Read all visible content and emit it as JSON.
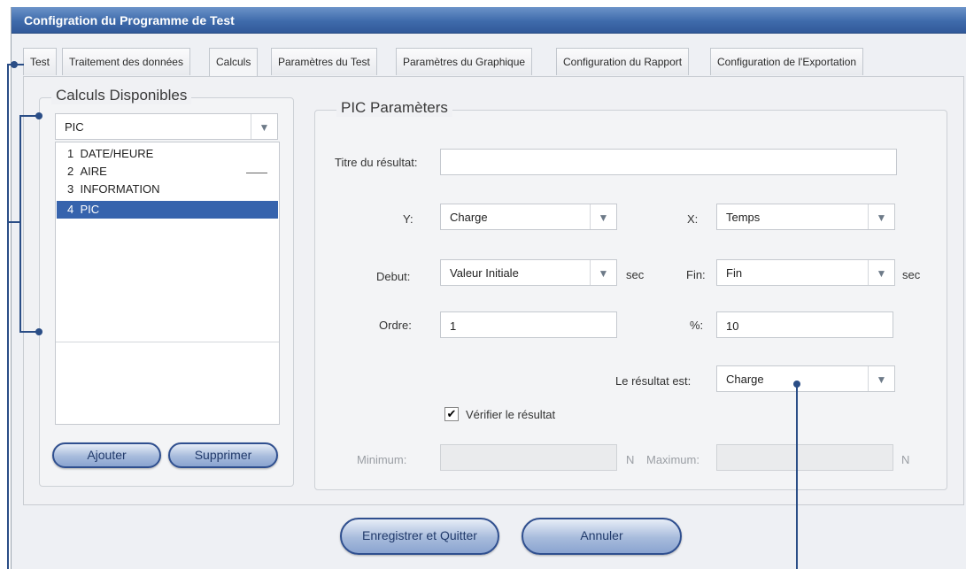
{
  "window": {
    "title": "Configration du Programme de Test"
  },
  "tabs": [
    {
      "label": "Test"
    },
    {
      "label": "Traitement des données"
    },
    {
      "label": "Calculs"
    },
    {
      "label": "Paramètres du Test"
    },
    {
      "label": "Paramètres du Graphique"
    },
    {
      "label": "Configuration du Rapport"
    },
    {
      "label": "Configuration de l'Exportation"
    }
  ],
  "calculs": {
    "legend": "Calculs Disponibles",
    "dropdown_value": "PIC",
    "items": [
      {
        "num": "1",
        "label": "DATE/HEURE",
        "selected": false
      },
      {
        "num": "2",
        "label": "AIRE",
        "selected": false
      },
      {
        "num": "3",
        "label": "INFORMATION",
        "selected": false
      },
      {
        "num": "4",
        "label": "PIC",
        "selected": true
      }
    ],
    "add_label": "Ajouter",
    "delete_label": "Supprimer"
  },
  "params": {
    "legend": "PIC Paramèters",
    "titre_label": "Titre du résultat:",
    "titre_value": "",
    "y_label": "Y:",
    "y_value": "Charge",
    "x_label": "X:",
    "x_value": "Temps",
    "debut_label": "Debut:",
    "debut_value": "Valeur Initiale",
    "debut_unit": "sec",
    "fin_label": "Fin:",
    "fin_value": "Fin",
    "fin_unit": "sec",
    "ordre_label": "Ordre:",
    "ordre_value": "1",
    "pct_label": "%:",
    "pct_value": "10",
    "resultat_label": "Le résultat est:",
    "resultat_value": "Charge",
    "verifier_label": "Vérifier le résultat",
    "verifier_checked": true,
    "min_label": "Minimum:",
    "min_value": "",
    "min_unit": "N",
    "max_label": "Maximum:",
    "max_value": "",
    "max_unit": "N"
  },
  "footer": {
    "save_label": "Enregistrer et Quitter",
    "cancel_label": "Annuler"
  },
  "icons": {
    "dropdown_arrow": "▼",
    "check": "✔"
  },
  "colors": {
    "title_bar": "#3f6bab",
    "selection": "#3663ad",
    "callout": "#2a4d86"
  }
}
